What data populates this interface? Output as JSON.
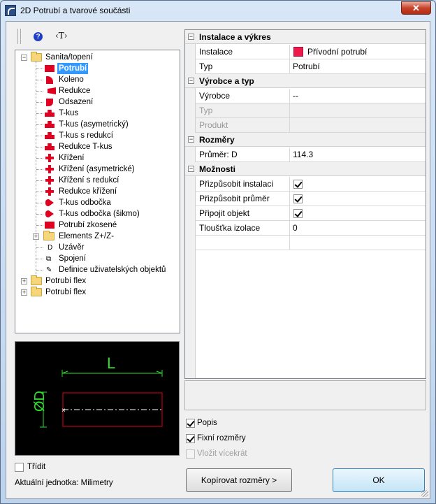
{
  "window": {
    "title": "2D Potrubí a tvarové součásti",
    "close_label": "✕"
  },
  "toolbar": {
    "help_icon": "?",
    "text_icon": "‹T›"
  },
  "tree": {
    "root": "Sanita/topení",
    "items": [
      "Potrubí",
      "Koleno",
      "Redukce",
      "Odsazení",
      "T-kus",
      "T-kus (asymetrický)",
      "T-kus s redukcí",
      "Redukce T-kus",
      "Křížení",
      "Křížení (asymetrické)",
      "Křížení s redukcí",
      "Redukce křížení",
      "T-kus odbočka",
      "T-kus odbočka (šikmo)",
      "Potrubí zkosené",
      "Elements Z+/Z-",
      "Uzávěr",
      "Spojení",
      "Definice uživatelských objektů"
    ],
    "siblings": [
      "Potrubí flex",
      "Potrubí flex"
    ],
    "plug_icon_letter": "D"
  },
  "preview": {
    "dimension_length": "L",
    "dimension_diameter": "ØD"
  },
  "sort": {
    "label": "Třídit",
    "checked": false
  },
  "unit": {
    "text": "Aktuální jednotka: Milimetry"
  },
  "properties": {
    "categories": [
      {
        "title": "Instalace a výkres",
        "rows": [
          {
            "name": "Instalace",
            "value": "Přívodní potrubí"
          },
          {
            "name": "Typ",
            "value": "Potrubí"
          }
        ]
      },
      {
        "title": "Výrobce a typ",
        "rows": [
          {
            "name": "Výrobce",
            "value": "--"
          },
          {
            "name": "Typ",
            "value": ""
          },
          {
            "name": "Produkt",
            "value": ""
          }
        ]
      },
      {
        "title": "Rozměry",
        "rows": [
          {
            "name": "Průměr: D",
            "value": "114.3"
          }
        ]
      },
      {
        "title": "Možnosti",
        "rows": [
          {
            "name": "Přizpůsobit instalaci",
            "checked": true
          },
          {
            "name": "Přizpůsobit průměr",
            "checked": true
          },
          {
            "name": "Připojit objekt",
            "checked": true
          },
          {
            "name": "Tloušťka izolace",
            "value": "0"
          }
        ]
      }
    ],
    "collapse_symbol": "−",
    "installation_color": "#ee1a4e"
  },
  "options": {
    "popis": {
      "label": "Popis",
      "checked": true
    },
    "fixni": {
      "label": "Fixní rozměry",
      "checked": true
    },
    "vlozit": {
      "label": "Vložit vícekrát",
      "checked": false,
      "disabled": true
    }
  },
  "buttons": {
    "copy": "Kopírovat rozměry >",
    "ok": "OK"
  }
}
